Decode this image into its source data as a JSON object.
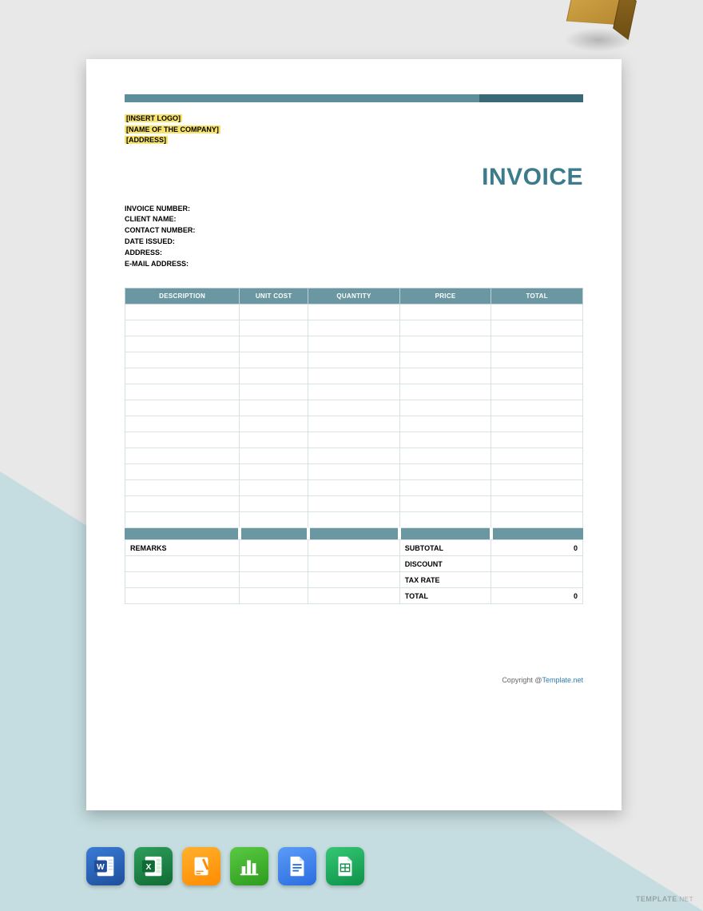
{
  "header": {
    "placeholders": [
      "[INSERT LOGO]",
      "[NAME OF THE COMPANY]",
      "[ADDRESS]"
    ],
    "title": "INVOICE"
  },
  "meta": {
    "invoice_number": "INVOICE NUMBER:",
    "client_name": "CLIENT NAME:",
    "contact_number": "CONTACT NUMBER:",
    "date_issued": "DATE ISSUED:",
    "address": "ADDRESS:",
    "email": "E-MAIL ADDRESS:"
  },
  "table": {
    "columns": [
      "DESCRIPTION",
      "UNIT COST",
      "QUANTITY",
      "PRICE",
      "TOTAL"
    ],
    "empty_rows": 14
  },
  "summary": {
    "remarks_label": "REMARKS",
    "rows": [
      {
        "label": "SUBTOTAL",
        "value": "0"
      },
      {
        "label": "DISCOUNT",
        "value": ""
      },
      {
        "label": "TAX RATE",
        "value": ""
      },
      {
        "label": "TOTAL",
        "value": "0"
      }
    ]
  },
  "footer": {
    "copyright_prefix": "Copyright @",
    "copyright_link": "Template.net"
  },
  "watermark": {
    "brand": "TEMPLATE",
    "suffix": ".NET"
  },
  "app_icons": [
    "word-icon",
    "excel-icon",
    "pages-icon",
    "numbers-icon",
    "google-docs-icon",
    "google-sheets-icon"
  ]
}
